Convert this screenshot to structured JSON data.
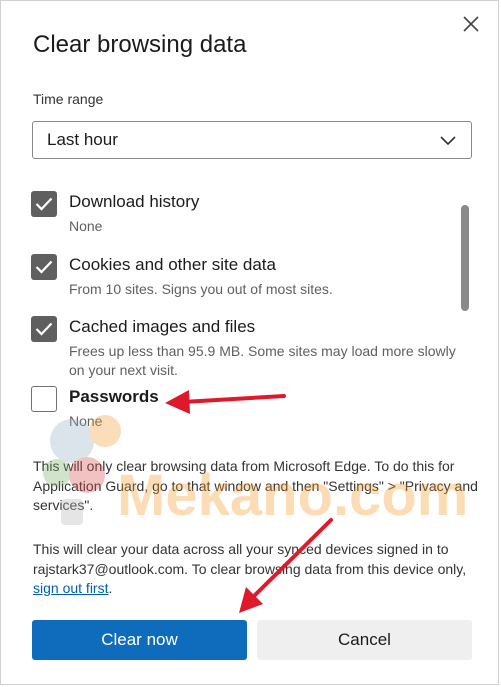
{
  "dialog": {
    "title": "Clear browsing data",
    "close_icon": "close-icon"
  },
  "time_range": {
    "label": "Time range",
    "selected": "Last hour",
    "icon": "chevron-down-icon"
  },
  "items": [
    {
      "label": "Download history",
      "description": "None",
      "checked": true
    },
    {
      "label": "Cookies and other site data",
      "description": "From 10 sites. Signs you out of most sites.",
      "checked": true
    },
    {
      "label": "Cached images and files",
      "description": "Frees up less than 95.9 MB. Some sites may load more slowly on your next visit.",
      "checked": true
    },
    {
      "label": "Passwords",
      "description": "None",
      "checked": false
    }
  ],
  "notes": {
    "app_guard": "This will only clear browsing data from Microsoft Edge. To do this for Application Guard, go to that window and then \"Settings\" > \"Privacy and services\".",
    "sync_prefix": "This will clear your data across all your synced devices signed in to rajstark37@outlook.com. To clear browsing data from this device only, ",
    "sync_link": "sign out first",
    "sync_suffix": "."
  },
  "buttons": {
    "clear_now": "Clear now",
    "cancel": "Cancel"
  },
  "watermark": {
    "text": "Mekano.com"
  },
  "colors": {
    "primary": "#0f6cbd",
    "checkbox": "#5f5f5f",
    "annotation_arrow": "#e0192a",
    "link": "#005fb8"
  }
}
